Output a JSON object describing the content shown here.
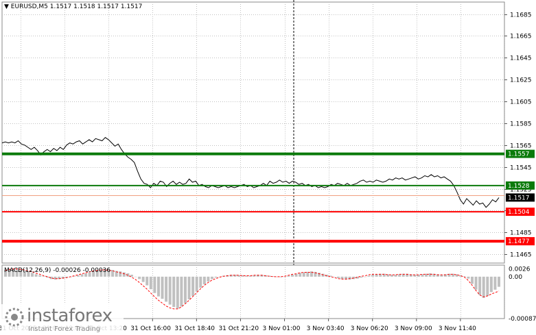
{
  "header": {
    "symbol_info": "EURUSD,M5  1.1517 1.1518 1.1517 1.1517",
    "macd_info": "MACD(12,26,9) -0.00026 -0.00036"
  },
  "logo": {
    "name": "instaforex",
    "tagline": "Instant Forex Trading"
  },
  "colors": {
    "price_line": "#000000",
    "grid": "#c0c0c0",
    "support_resistance_green": "#0a7a0a",
    "support_resistance_red": "#ff0000",
    "bid_line": "#f0a080",
    "histogram": "#c0c0c0",
    "signal": "#ff0000"
  },
  "chart_data": [
    {
      "type": "line",
      "title": "EURUSD,M5",
      "ylim": [
        1.1457,
        1.1696
      ],
      "y_ticks": [
        "1.1685",
        "1.1665",
        "1.1645",
        "1.1625",
        "1.1605",
        "1.1585",
        "1.1565",
        "1.1545",
        "1.1525",
        "1.1505",
        "1.1485",
        "1.1465"
      ],
      "x_ticks": [
        "31 Oct 2025",
        "31 Oct 12:00",
        "31 Oct 13:20",
        "31 Oct 16:00",
        "31 Oct 18:40",
        "31 Oct 21:20",
        "3 Nov 01:00",
        "3 Nov 03:40",
        "3 Nov 06:20",
        "3 Nov 09:00",
        "3 Nov 11:40"
      ],
      "grid": true,
      "series": [
        {
          "values": [
            1.1567,
            1.1568,
            1.1567,
            1.1568,
            1.1567,
            1.1569,
            1.1566,
            1.1565,
            1.1563,
            1.1561,
            1.1563,
            1.156,
            1.1556,
            1.1559,
            1.1561,
            1.1559,
            1.1562,
            1.156,
            1.1563,
            1.1561,
            1.1565,
            1.1567,
            1.1566,
            1.1568,
            1.1569,
            1.1566,
            1.1568,
            1.157,
            1.1568,
            1.1571,
            1.157,
            1.1569,
            1.1572,
            1.157,
            1.1567,
            1.1564,
            1.1566,
            1.1561,
            1.1557,
            1.1554,
            1.1552,
            1.1549,
            1.1541,
            1.1534,
            1.153,
            1.1529,
            1.1526,
            1.153,
            1.1528,
            1.1532,
            1.1531,
            1.1527,
            1.153,
            1.1532,
            1.1529,
            1.1531,
            1.1529,
            1.153,
            1.1534,
            1.1531,
            1.1532,
            1.1528,
            1.1529,
            1.1527,
            1.1526,
            1.1528,
            1.1527,
            1.1526,
            1.1527,
            1.1528,
            1.1526,
            1.1527,
            1.1526,
            1.1527,
            1.1528,
            1.1529,
            1.1527,
            1.1528,
            1.1526,
            1.1527,
            1.1528,
            1.153,
            1.1528,
            1.1532,
            1.153,
            1.1531,
            1.1533,
            1.1531,
            1.1532,
            1.153,
            1.1532,
            1.1531,
            1.1529,
            1.153,
            1.1528,
            1.1529,
            1.1527,
            1.1528,
            1.1526,
            1.1527,
            1.1526,
            1.1527,
            1.1529,
            1.1528,
            1.153,
            1.1529,
            1.1528,
            1.153,
            1.1528,
            1.1529,
            1.153,
            1.1532,
            1.1533,
            1.1531,
            1.1532,
            1.1531,
            1.1533,
            1.1532,
            1.1531,
            1.1532,
            1.1534,
            1.1533,
            1.1535,
            1.1534,
            1.1535,
            1.1533,
            1.1534,
            1.1535,
            1.1536,
            1.1534,
            1.1535,
            1.1537,
            1.1536,
            1.1538,
            1.1536,
            1.1537,
            1.1535,
            1.1536,
            1.1534,
            1.1532,
            1.1528,
            1.1522,
            1.1515,
            1.1511,
            1.1516,
            1.1513,
            1.151,
            1.1514,
            1.1511,
            1.1512,
            1.1508,
            1.1511,
            1.1515,
            1.1513,
            1.1517
          ]
        }
      ],
      "horizontal_levels": [
        {
          "label": "1.1557",
          "value": 1.1557,
          "color": "#0a7a0a",
          "thickness": "thick"
        },
        {
          "label": "1.1528",
          "value": 1.1528,
          "color": "#0a7a0a",
          "thickness": "thin"
        },
        {
          "label": "1.1504",
          "value": 1.1504,
          "color": "#ff0000",
          "thickness": "thin"
        },
        {
          "label": "1.1477",
          "value": 1.1477,
          "color": "#ff0000",
          "thickness": "thick"
        }
      ],
      "current_price": {
        "label": "1.1517",
        "value": 1.1517
      }
    },
    {
      "type": "bar",
      "title": "MACD(12,26,9)",
      "ylim": [
        -0.00087,
        0.00024
      ],
      "y_ticks": [
        "0.0026",
        "0.00",
        "-0.00087"
      ],
      "series": [
        {
          "name": "histogram",
          "values": [
            0.00014,
            0.00016,
            0.00017,
            0.00016,
            0.00015,
            0.00013,
            0.00011,
            8e-05,
            5e-05,
            3e-05,
            1e-05,
            -2e-05,
            -5e-05,
            -6e-05,
            -5e-05,
            -4e-05,
            -2e-05,
            -1e-05,
            1e-05,
            3e-05,
            5e-05,
            7e-05,
            9e-05,
            0.00011,
            0.00013,
            0.00014,
            0.00015,
            0.00015,
            0.00014,
            0.00012,
            0.00011,
            9e-05,
            7e-05,
            4e-05,
            0.0,
            -5e-05,
            -0.00011,
            -0.00018,
            -0.00026,
            -0.00034,
            -0.00041,
            -0.00046,
            -0.00052,
            -0.00058,
            -0.00063,
            -0.00066,
            -0.00062,
            -0.00055,
            -0.00047,
            -0.0004,
            -0.00031,
            -0.00023,
            -0.00016,
            -0.0001,
            -5e-05,
            -2e-05,
            0.0,
            2e-05,
            3e-05,
            4e-05,
            4e-05,
            3e-05,
            3e-05,
            2e-05,
            2e-05,
            3e-05,
            4e-05,
            4e-05,
            3e-05,
            2e-05,
            1e-05,
            0.0,
            -1e-05,
            0.0,
            2e-05,
            4e-05,
            6e-05,
            8e-05,
            9e-05,
            0.0001,
            0.00011,
            0.0001,
            8e-05,
            6e-05,
            4e-05,
            2e-05,
            0.0,
            -3e-05,
            -5e-05,
            -6e-05,
            -6e-05,
            -5e-05,
            -4e-05,
            -2e-05,
            0.0,
            2e-05,
            4e-05,
            5e-05,
            6e-05,
            6e-05,
            5e-05,
            4e-05,
            4e-05,
            5e-05,
            6e-05,
            6e-05,
            5e-05,
            4e-05,
            4e-05,
            5e-05,
            6e-05,
            7e-05,
            6e-05,
            5e-05,
            4e-05,
            5e-05,
            6e-05,
            6e-05,
            5e-05,
            3e-05,
            1e-05,
            -4e-05,
            -0.00015,
            -0.00027,
            -0.00038,
            -0.00044,
            -0.0004,
            -0.00032,
            -0.00027,
            -0.00021
          ]
        },
        {
          "name": "signal",
          "values": [
            0.00013,
            0.00015,
            0.00016,
            0.00016,
            0.00015,
            0.00014,
            0.00012,
            0.0001,
            7e-05,
            5e-05,
            2e-05,
            0.0,
            -3e-05,
            -4e-05,
            -4e-05,
            -3e-05,
            -2e-05,
            0.0,
            2e-05,
            4e-05,
            6e-05,
            8e-05,
            0.0001,
            0.00012,
            0.00013,
            0.00014,
            0.00014,
            0.00013,
            0.00012,
            0.0001,
            8e-05,
            6e-05,
            3e-05,
            -1e-05,
            -6e-05,
            -0.00012,
            -0.00019,
            -0.00026,
            -0.00034,
            -0.00042,
            -0.00049,
            -0.00055,
            -0.00061,
            -0.00065,
            -0.00067,
            -0.00067,
            -0.00063,
            -0.00056,
            -0.00049,
            -0.00041,
            -0.00033,
            -0.00025,
            -0.00018,
            -0.00012,
            -7e-05,
            -4e-05,
            -1e-05,
            1e-05,
            2e-05,
            3e-05,
            3e-05,
            3e-05,
            2e-05,
            2e-05,
            2e-05,
            3e-05,
            3e-05,
            3e-05,
            2e-05,
            1e-05,
            0.0,
            0.0,
            0.0,
            1e-05,
            3e-05,
            5e-05,
            6e-05,
            8e-05,
            9e-05,
            9e-05,
            9e-05,
            8e-05,
            6e-05,
            4e-05,
            2e-05,
            0.0,
            -2e-05,
            -4e-05,
            -5e-05,
            -5e-05,
            -4e-05,
            -3e-05,
            -1e-05,
            1e-05,
            2e-05,
            4e-05,
            5e-05,
            5e-05,
            5e-05,
            5e-05,
            4e-05,
            4e-05,
            4e-05,
            5e-05,
            5e-05,
            5e-05,
            4e-05,
            4e-05,
            4e-05,
            5e-05,
            5e-05,
            5e-05,
            5e-05,
            4e-05,
            4e-05,
            4e-05,
            5e-05,
            5e-05,
            4e-05,
            2e-05,
            -1e-05,
            -8e-05,
            -0.00018,
            -0.00029,
            -0.00038,
            -0.00042,
            -0.0004,
            -0.00036,
            -0.00033,
            -0.0003
          ]
        }
      ]
    }
  ]
}
